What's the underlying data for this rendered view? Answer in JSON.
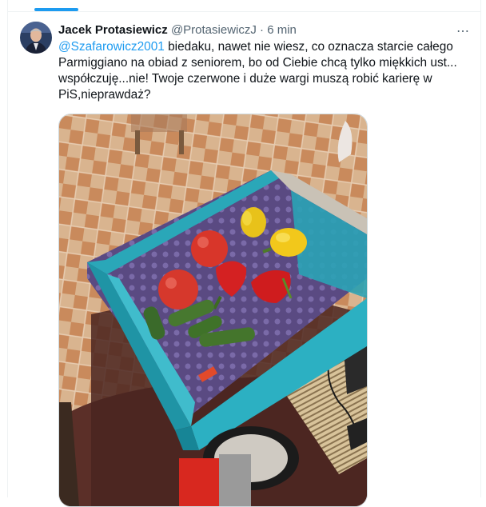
{
  "tweet": {
    "author_name": "Jacek Protasiewicz",
    "author_handle": "@ProtasiewiczJ",
    "separator": "·",
    "timestamp": "6 min",
    "more_icon": "⋯",
    "mention": "@Szafarowicz2001",
    "text_line1": " biedaku, nawet nie wiesz, co oznacza starcie całego",
    "text_line2": "Parmiggiano na obiad z seniorem, bo od Ciebie chcą tylko miękkich ust...",
    "text_line3": "współczuję...nie! Twoje czerwone i duże wargi muszą robić karierę w",
    "text_line4": "PiS,nieprawdaż?"
  },
  "colors": {
    "accent": "#1d9bf0",
    "text_primary": "#0f1419",
    "text_secondary": "#536471"
  },
  "icons": {
    "more": "more-options-icon"
  }
}
